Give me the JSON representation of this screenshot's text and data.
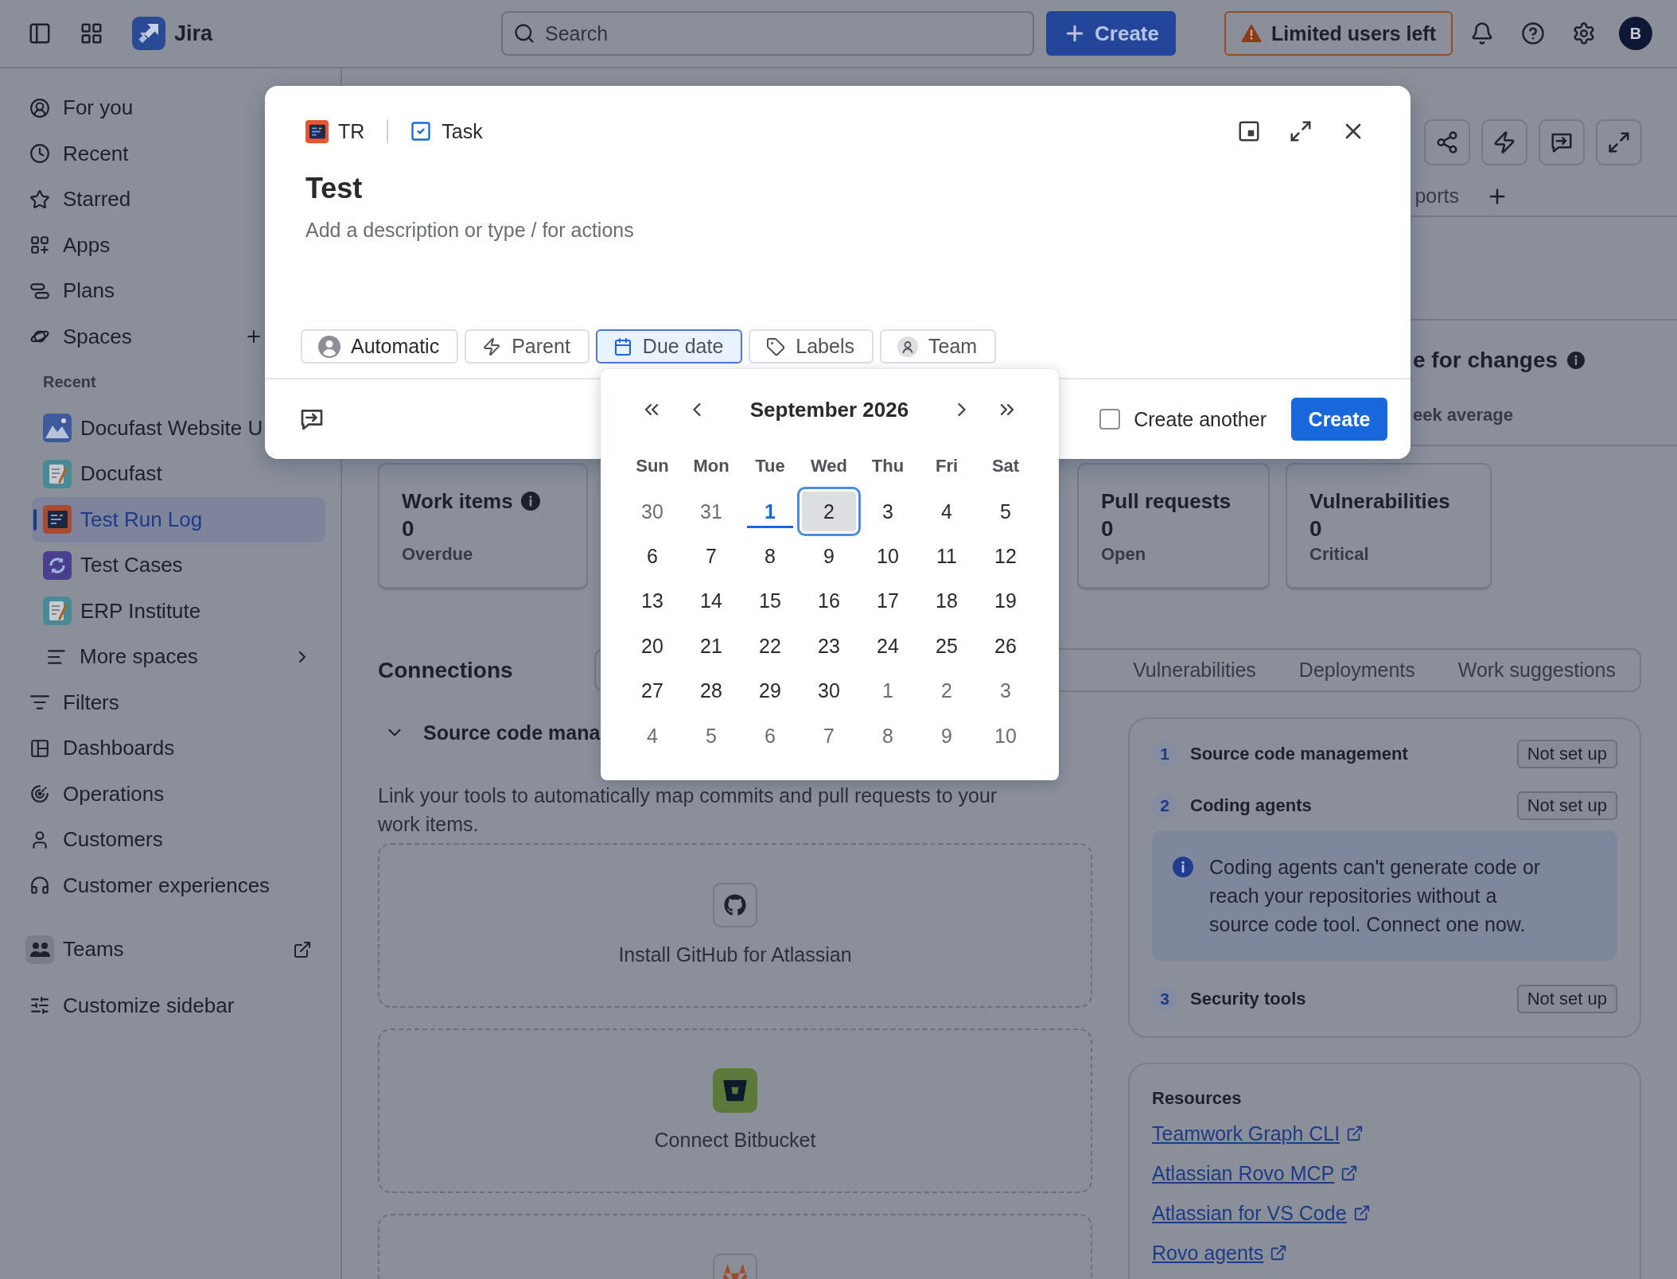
{
  "top_bar": {
    "product": "Jira",
    "search_placeholder": "Search",
    "create": "Create",
    "alert": "Limited users left",
    "avatar": "B"
  },
  "sidebar": {
    "nav": [
      {
        "label": "For you",
        "selected": false
      },
      {
        "label": "Recent",
        "selected": false
      },
      {
        "label": "Starred",
        "selected": false
      },
      {
        "label": "Apps",
        "selected": false
      },
      {
        "label": "Plans",
        "selected": false
      },
      {
        "label": "Spaces",
        "selected": false
      }
    ],
    "recent_heading": "Recent",
    "spaces": [
      {
        "label": "Docufast Website U",
        "selected": false
      },
      {
        "label": "Docufast",
        "selected": false
      },
      {
        "label": "Test Run Log",
        "selected": true
      },
      {
        "label": "Test Cases",
        "selected": false
      },
      {
        "label": "ERP Institute",
        "selected": false
      }
    ],
    "more_spaces": "More spaces",
    "tools": [
      {
        "label": "Filters",
        "selected": false
      },
      {
        "label": "Dashboards",
        "selected": false
      },
      {
        "label": "Operations",
        "selected": false
      },
      {
        "label": "Customers",
        "selected": false
      },
      {
        "label": "Customer experiences",
        "selected": false
      }
    ],
    "teams": "Teams",
    "customize": "Customize sidebar"
  },
  "page": {
    "tab_fragment": "ports",
    "insight": {
      "title": "e for changes",
      "subtitle": "eek average"
    },
    "stats": [
      {
        "title": "Work items",
        "value": "0",
        "caption": "Overdue",
        "info": true
      },
      {
        "title": "Pull requests",
        "value": "0",
        "caption": "Open",
        "info": false
      },
      {
        "title": "Vulnerabilities",
        "value": "0",
        "caption": "Critical",
        "info": false
      }
    ],
    "connections": {
      "heading": "Connections",
      "tabs": [
        "Vulnerabilities",
        "Deployments",
        "Work suggestions"
      ],
      "section": {
        "title": "Source code mana",
        "expanded": true
      },
      "description": "Link your tools to automatically map commits and pull requests to your work items.",
      "providers": [
        {
          "label": "Install GitHub for Atlassian"
        },
        {
          "label": "Connect Bitbucket"
        }
      ],
      "more_cards_below": true
    },
    "setup_steps": [
      {
        "number": "1",
        "label": "Source code management",
        "status": "Not set up"
      },
      {
        "number": "2",
        "label": "Coding agents",
        "status": "Not set up",
        "note": "Coding agents can't generate code or reach your repositories without a source code tool. Connect one now."
      },
      {
        "number": "3",
        "label": "Security tools",
        "status": "Not set up"
      }
    ],
    "resources": {
      "heading": "Resources",
      "links": [
        "Teamwork Graph CLI",
        "Atlassian Rovo MCP",
        "Atlassian for VS Code",
        "Rovo agents"
      ]
    }
  },
  "modal": {
    "space_key": "TR",
    "work_type": "Task",
    "title": "Test",
    "description_placeholder": "Add a description or type / for actions",
    "fields": [
      {
        "label": "Automatic",
        "set": true,
        "selected": false
      },
      {
        "label": "Parent",
        "set": false,
        "selected": false
      },
      {
        "label": "Due date",
        "set": false,
        "selected": true
      },
      {
        "label": "Labels",
        "set": false,
        "selected": false
      },
      {
        "label": "Team",
        "set": false,
        "selected": false
      }
    ],
    "create_another": {
      "label": "Create another",
      "checked": false
    },
    "create_button": "Create"
  },
  "date_picker": {
    "month": "September 2026",
    "weekdays": [
      "Sun",
      "Mon",
      "Tue",
      "Wed",
      "Thu",
      "Fri",
      "Sat"
    ],
    "weeks": [
      [
        {
          "day": "30",
          "in_month": false,
          "today": false,
          "selected": false
        },
        {
          "day": "31",
          "in_month": false,
          "today": false,
          "selected": false
        },
        {
          "day": "1",
          "in_month": true,
          "today": true,
          "selected": false
        },
        {
          "day": "2",
          "in_month": true,
          "today": false,
          "selected": true
        },
        {
          "day": "3",
          "in_month": true,
          "today": false,
          "selected": false
        },
        {
          "day": "4",
          "in_month": true,
          "today": false,
          "selected": false
        },
        {
          "day": "5",
          "in_month": true,
          "today": false,
          "selected": false
        }
      ],
      [
        {
          "day": "6",
          "in_month": true,
          "today": false,
          "selected": false
        },
        {
          "day": "7",
          "in_month": true,
          "today": false,
          "selected": false
        },
        {
          "day": "8",
          "in_month": true,
          "today": false,
          "selected": false
        },
        {
          "day": "9",
          "in_month": true,
          "today": false,
          "selected": false
        },
        {
          "day": "10",
          "in_month": true,
          "today": false,
          "selected": false
        },
        {
          "day": "11",
          "in_month": true,
          "today": false,
          "selected": false
        },
        {
          "day": "12",
          "in_month": true,
          "today": false,
          "selected": false
        }
      ],
      [
        {
          "day": "13",
          "in_month": true,
          "today": false,
          "selected": false
        },
        {
          "day": "14",
          "in_month": true,
          "today": false,
          "selected": false
        },
        {
          "day": "15",
          "in_month": true,
          "today": false,
          "selected": false
        },
        {
          "day": "16",
          "in_month": true,
          "today": false,
          "selected": false
        },
        {
          "day": "17",
          "in_month": true,
          "today": false,
          "selected": false
        },
        {
          "day": "18",
          "in_month": true,
          "today": false,
          "selected": false
        },
        {
          "day": "19",
          "in_month": true,
          "today": false,
          "selected": false
        }
      ],
      [
        {
          "day": "20",
          "in_month": true,
          "today": false,
          "selected": false
        },
        {
          "day": "21",
          "in_month": true,
          "today": false,
          "selected": false
        },
        {
          "day": "22",
          "in_month": true,
          "today": false,
          "selected": false
        },
        {
          "day": "23",
          "in_month": true,
          "today": false,
          "selected": false
        },
        {
          "day": "24",
          "in_month": true,
          "today": false,
          "selected": false
        },
        {
          "day": "25",
          "in_month": true,
          "today": false,
          "selected": false
        },
        {
          "day": "26",
          "in_month": true,
          "today": false,
          "selected": false
        }
      ],
      [
        {
          "day": "27",
          "in_month": true,
          "today": false,
          "selected": false
        },
        {
          "day": "28",
          "in_month": true,
          "today": false,
          "selected": false
        },
        {
          "day": "29",
          "in_month": true,
          "today": false,
          "selected": false
        },
        {
          "day": "30",
          "in_month": true,
          "today": false,
          "selected": false
        },
        {
          "day": "1",
          "in_month": false,
          "today": false,
          "selected": false
        },
        {
          "day": "2",
          "in_month": false,
          "today": false,
          "selected": false
        },
        {
          "day": "3",
          "in_month": false,
          "today": false,
          "selected": false
        }
      ],
      [
        {
          "day": "4",
          "in_month": false,
          "today": false,
          "selected": false
        },
        {
          "day": "5",
          "in_month": false,
          "today": false,
          "selected": false
        },
        {
          "day": "6",
          "in_month": false,
          "today": false,
          "selected": false
        },
        {
          "day": "7",
          "in_month": false,
          "today": false,
          "selected": false
        },
        {
          "day": "8",
          "in_month": false,
          "today": false,
          "selected": false
        },
        {
          "day": "9",
          "in_month": false,
          "today": false,
          "selected": false
        },
        {
          "day": "10",
          "in_month": false,
          "today": false,
          "selected": false
        }
      ]
    ]
  }
}
